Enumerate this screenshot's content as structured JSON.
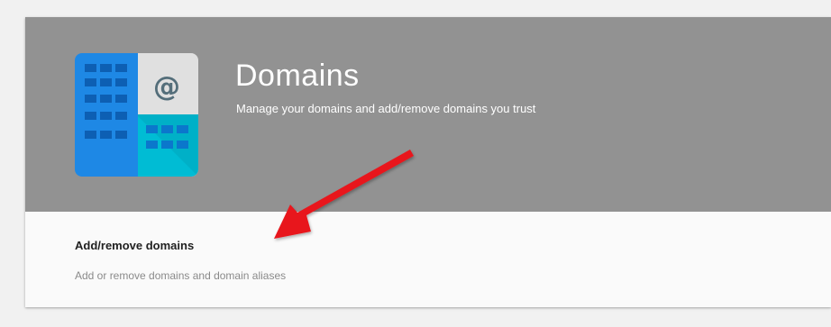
{
  "header": {
    "title": "Domains",
    "subtitle": "Manage your domains and add/remove domains you trust",
    "icon": "domains-building-icon",
    "icon_symbol": "@"
  },
  "section": {
    "item_title": "Add/remove domains",
    "item_description": "Add or remove domains and domain aliases"
  },
  "annotation": {
    "type": "red-arrow",
    "color": "#e8161b"
  },
  "colors": {
    "header_bg": "#929292",
    "card_bg": "#fafafa",
    "page_bg": "#f1f1f1",
    "building_blue": "#1e88e5",
    "building_cyan": "#00bcd4"
  }
}
